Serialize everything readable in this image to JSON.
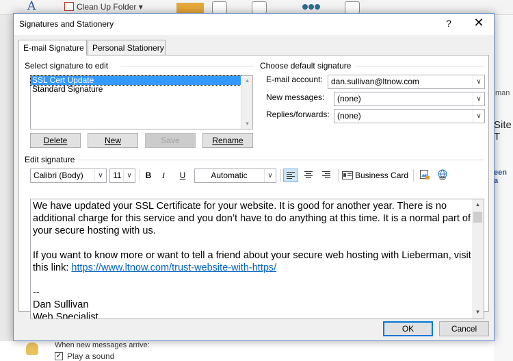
{
  "background": {
    "ribbon_a": "A",
    "clean_up_folder": "Clean Up Folder",
    "right_text_1": "man",
    "right_text_2": "Site T",
    "right_text_3": "een a",
    "bottom_label": "When new messages arrive:",
    "bottom_checkbox_mark": "✓",
    "bottom_checkbox_label": "Play a sound"
  },
  "dialog": {
    "title": "Signatures and Stationery",
    "help": "?",
    "close": "✕",
    "tabs": [
      {
        "label": "E-mail Signature",
        "active": true
      },
      {
        "label": "Personal Stationery",
        "active": false
      }
    ]
  },
  "select_group": {
    "label": "Select signature to edit",
    "signatures": [
      "SSL Cert Update",
      "Standard Signature"
    ],
    "selected": "SSL Cert Update"
  },
  "buttons": {
    "delete": "Delete",
    "new": "New",
    "save": "Save",
    "rename": "Rename",
    "ok": "OK",
    "cancel": "Cancel"
  },
  "defaults_group": {
    "label": "Choose default signature",
    "email_account_label": "E-mail account:",
    "email_account_value": "dan.sullivan@ltnow.com",
    "new_messages_label": "New messages:",
    "new_messages_value": "(none)",
    "replies_label": "Replies/forwards:",
    "replies_value": "(none)"
  },
  "edit_group": {
    "label": "Edit signature",
    "font": "Calibri (Body)",
    "size": "11",
    "bold": "B",
    "italic": "I",
    "underline": "U",
    "color": "Automatic",
    "business_card": "Business Card"
  },
  "signature_body": {
    "para1": "We have updated your SSL Certificate for your website. It is good for another year. There is no additional charge for this service and you don’t have to do anything at this time. It is a normal part of your secure hosting with us.",
    "para2_text": "If you want to know more or want to tell a friend about your secure web hosting with Lieberman, visit this link: ",
    "para2_link": "https://www.ltnow.com/trust-website-with-https/",
    "sig_dashes": "--",
    "sig_name": "Dan Sullivan",
    "sig_title": "Web Specialist"
  }
}
